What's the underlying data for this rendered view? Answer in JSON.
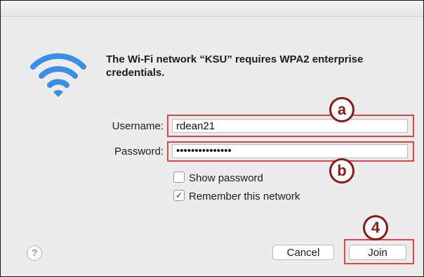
{
  "dialog": {
    "message": "The Wi-Fi network “KSU” requires WPA2 enterprise credentials.",
    "wifi_icon": "wifi-icon",
    "accent_color": "#3a8ee6"
  },
  "form": {
    "username_label": "Username:",
    "username_value": "rdean21",
    "password_label": "Password:",
    "password_value": "•••••••••••••••",
    "show_password_label": "Show password",
    "show_password_checked": false,
    "remember_label": "Remember this network",
    "remember_checked": true,
    "remember_mark": "✓"
  },
  "buttons": {
    "help": "?",
    "cancel": "Cancel",
    "join": "Join"
  },
  "annotations": {
    "badge_a": "a",
    "badge_b": "b",
    "badge_4": "4",
    "highlight_color": "#e04545",
    "badge_color": "#8b1a1a"
  }
}
